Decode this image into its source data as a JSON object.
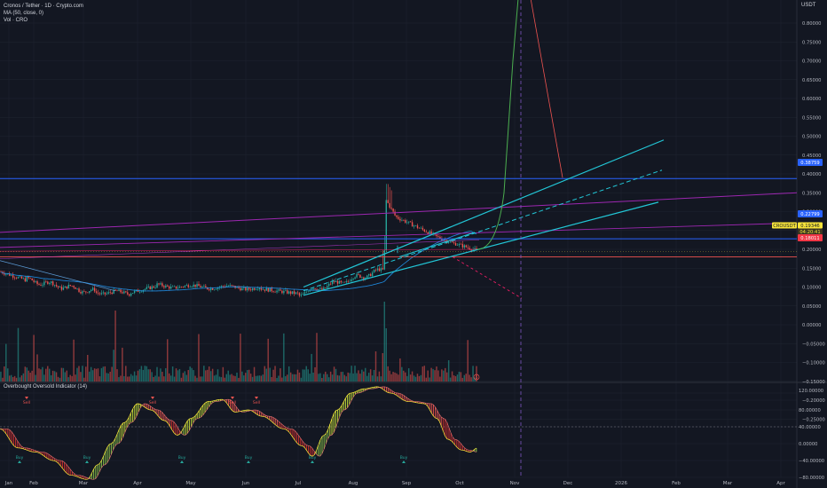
{
  "header": {
    "symbol_line": "Cronos / Tether · 1D · Crypto.com",
    "ma_line": "MA (50, close, 0)",
    "vol_line": "Vol · CRO",
    "currency": "USDT"
  },
  "chart_data": [
    {
      "type": "line",
      "title": "Cronos / Tether · 1D · Crypto.com",
      "x": [
        "Jan",
        "Feb",
        "Mar",
        "Apr",
        "May",
        "Jun",
        "Jul",
        "Aug",
        "Sep",
        "Oct",
        "Nov",
        "Dec",
        "2026",
        "Feb",
        "Mar",
        "Apr"
      ],
      "ylim": [
        -0.27,
        0.9
      ],
      "yticks": [
        "0.80000",
        "0.75000",
        "0.70000",
        "0.65000",
        "0.60000",
        "0.55000",
        "0.50000",
        "0.45000",
        "0.40000",
        "0.35000",
        "0.30000",
        "0.25000",
        "0.20000",
        "0.15000",
        "0.10000",
        "0.05000",
        "0.00000",
        "−0.05000",
        "−0.10000",
        "−0.15000",
        "−0.20000",
        "−0.25000"
      ],
      "series": [
        {
          "name": "CROUSDT",
          "values": [
            0.14,
            0.105,
            0.09,
            0.1,
            0.095,
            0.1,
            0.095,
            0.09,
            0.15,
            0.26,
            0.205,
            0.18
          ]
        },
        {
          "name": "MA (50, close, 0)",
          "values": [
            0.14,
            0.12,
            0.1,
            0.095,
            0.092,
            0.092,
            0.093,
            0.092,
            0.11,
            0.165,
            0.2,
            0.205
          ]
        }
      ],
      "price_labels": [
        {
          "text": "0.38759",
          "color": "#2962ff"
        },
        {
          "text": "0.22799",
          "color": "#2962ff"
        },
        {
          "text": "CROUSDT",
          "color": "#f7e43a"
        },
        {
          "text": "0.19346",
          "color": "#f7e43a"
        },
        {
          "text": "04:20:41",
          "color": "#f7e43a"
        },
        {
          "text": "0.18011",
          "color": "#f23645"
        }
      ],
      "grid": true
    },
    {
      "type": "line",
      "title": "Overbought Oversold Indicator (14)",
      "ylim": [
        -135,
        130
      ],
      "yticks": [
        "120.00000",
        "80.00000",
        "40.00000",
        "0.00000",
        "−40.00000",
        "−80.00000",
        "−120.00000"
      ],
      "signals": [
        {
          "text": "Sell",
          "kind": "sell"
        },
        {
          "text": "Sell",
          "kind": "sell"
        },
        {
          "text": "Sell",
          "kind": "sell"
        },
        {
          "text": "Sell",
          "kind": "sell"
        },
        {
          "text": "Buy",
          "kind": "buy"
        },
        {
          "text": "Buy",
          "kind": "buy"
        },
        {
          "text": "Buy",
          "kind": "buy"
        },
        {
          "text": "Buy",
          "kind": "buy"
        },
        {
          "text": "Buy",
          "kind": "buy"
        },
        {
          "text": "Buy",
          "kind": "buy"
        }
      ]
    }
  ],
  "footer": {
    "date_marker": "5"
  },
  "colors": {
    "background": "#131722",
    "grid": "#1f2430",
    "up": "#26a69a",
    "down": "#ef5350",
    "blue_line": "#2962ff",
    "cyan_line": "#22c6d6",
    "magenta_line": "#9c27b0",
    "green_line": "#4caf50",
    "pink_line": "#e91e63",
    "yellow": "#f7e43a"
  }
}
